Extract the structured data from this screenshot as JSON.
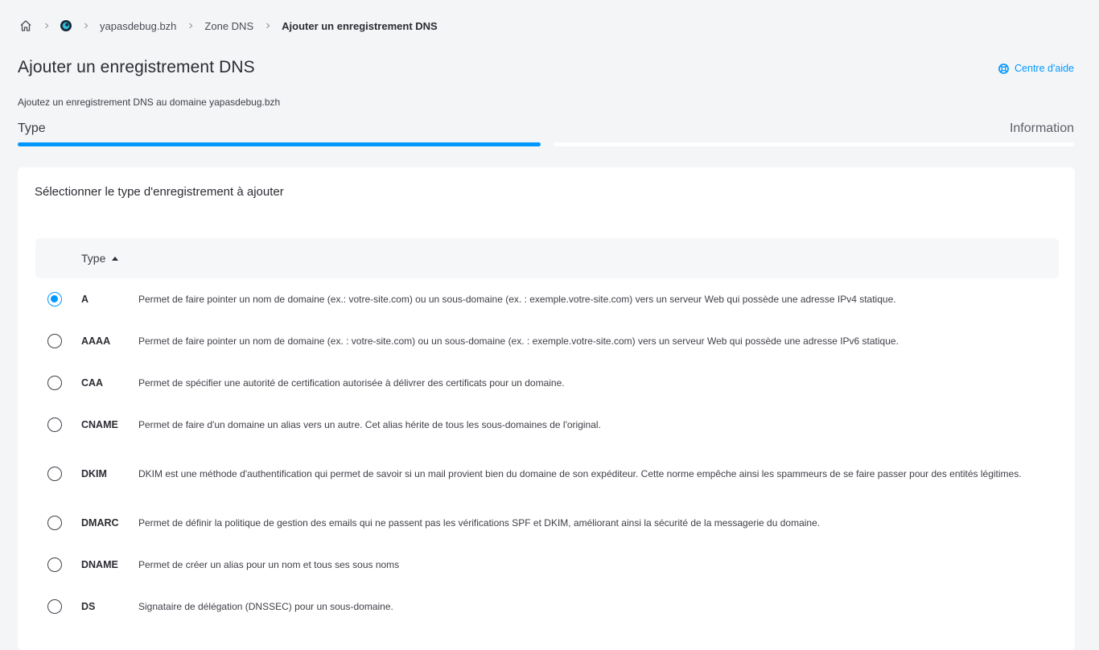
{
  "breadcrumb": {
    "home_icon": "home-icon",
    "product_icon": "product-logo-icon",
    "domain": "yapasdebug.bzh",
    "zone": "Zone DNS",
    "current": "Ajouter un enregistrement DNS"
  },
  "header": {
    "title": "Ajouter un enregistrement DNS",
    "help_label": "Centre d'aide",
    "help_icon": "lifebuoy-icon",
    "subtitle": "Ajoutez un enregistrement DNS au domaine yapasdebug.bzh"
  },
  "steps": [
    {
      "label": "Type",
      "active": true
    },
    {
      "label": "Information",
      "active": false
    }
  ],
  "colors": {
    "accent": "#0098ff",
    "background": "#f4f5f7",
    "card": "#ffffff"
  },
  "card": {
    "title": "Sélectionner le type d'enregistrement à ajouter",
    "column_type": "Type",
    "sort_icon": "sort-ascending-icon"
  },
  "records": [
    {
      "type": "A",
      "selected": true,
      "description": "Permet de faire pointer un nom de domaine (ex.: votre-site.com) ou un sous-domaine (ex. : exemple.votre-site.com) vers un serveur Web qui possède une adresse IPv4 statique."
    },
    {
      "type": "AAAA",
      "selected": false,
      "description": "Permet de faire pointer un nom de domaine (ex. : votre-site.com) ou un sous-domaine (ex. : exemple.votre-site.com) vers un serveur Web qui possède une adresse IPv6 statique."
    },
    {
      "type": "CAA",
      "selected": false,
      "description": "Permet de spécifier une autorité de certification autorisée à délivrer des certificats pour un domaine."
    },
    {
      "type": "CNAME",
      "selected": false,
      "description": "Permet de faire d'un domaine un alias vers un autre. Cet alias hérite de tous les sous-domaines de l'original."
    },
    {
      "type": "DKIM",
      "selected": false,
      "description": "DKIM est une méthode d'authentification qui permet de savoir si un mail provient bien du domaine de son expéditeur. Cette norme empêche ainsi les spammeurs de se faire passer pour des entités légitimes."
    },
    {
      "type": "DMARC",
      "selected": false,
      "description": "Permet de définir la politique de gestion des emails qui ne passent pas les vérifications SPF et DKIM, améliorant ainsi la sécurité de la messagerie du domaine."
    },
    {
      "type": "DNAME",
      "selected": false,
      "description": "Permet de créer un alias pour un nom et tous ses sous noms"
    },
    {
      "type": "DS",
      "selected": false,
      "description": "Signataire de délégation (DNSSEC) pour un sous-domaine."
    }
  ]
}
